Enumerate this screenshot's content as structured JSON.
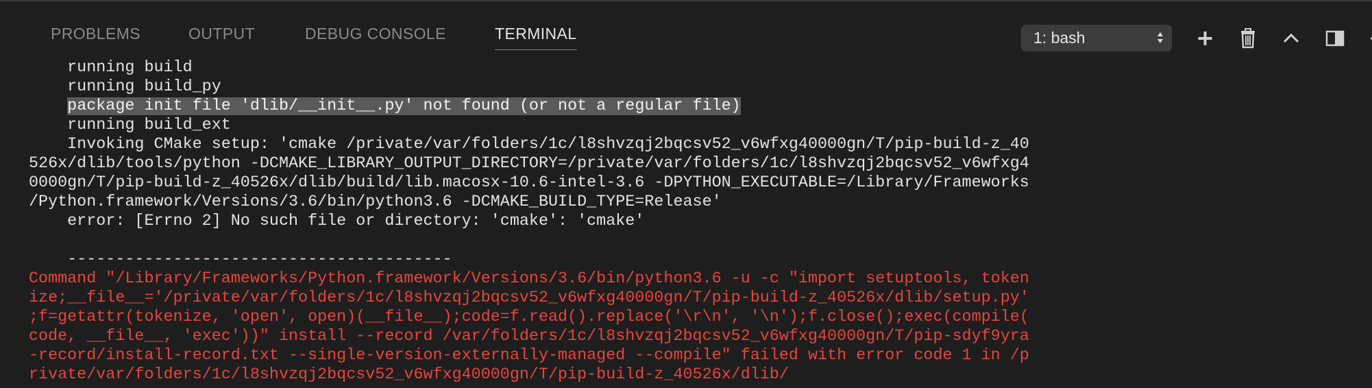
{
  "tabs": [
    {
      "label": "PROBLEMS"
    },
    {
      "label": "OUTPUT"
    },
    {
      "label": "DEBUG CONSOLE"
    },
    {
      "label": "TERMINAL",
      "active": true
    }
  ],
  "toolbar": {
    "terminal_select": "1: bash",
    "icons": [
      "plus-icon",
      "trash-icon",
      "chevron-up-icon",
      "split-panel-icon"
    ]
  },
  "terminal": {
    "lines": [
      "    running build",
      "    running build_py",
      {
        "pre": "    ",
        "selected": "package init file 'dlib/__init__.py' not found (or not a regular file)"
      },
      "    running build_ext",
      "    Invoking CMake setup: 'cmake /private/var/folders/1c/l8shvzqj2bqcsv52_v6wfxg40000gn/T/pip-build-z_40",
      "526x/dlib/tools/python -DCMAKE_LIBRARY_OUTPUT_DIRECTORY=/private/var/folders/1c/l8shvzqj2bqcsv52_v6wfxg4",
      "0000gn/T/pip-build-z_40526x/dlib/build/lib.macosx-10.6-intel-3.6 -DPYTHON_EXECUTABLE=/Library/Frameworks",
      "/Python.framework/Versions/3.6/bin/python3.6 -DCMAKE_BUILD_TYPE=Release'",
      "    error: [Errno 2] No such file or directory: 'cmake': 'cmake'",
      "",
      "    ----------------------------------------",
      {
        "err": "Command \"/Library/Frameworks/Python.framework/Versions/3.6/bin/python3.6 -u -c \"import setuptools, token"
      },
      {
        "err": "ize;__file__='/private/var/folders/1c/l8shvzqj2bqcsv52_v6wfxg40000gn/T/pip-build-z_40526x/dlib/setup.py'"
      },
      {
        "err": ";f=getattr(tokenize, 'open', open)(__file__);code=f.read().replace('\\r\\n', '\\n');f.close();exec(compile("
      },
      {
        "err": "code, __file__, 'exec'))\" install --record /var/folders/1c/l8shvzqj2bqcsv52_v6wfxg40000gn/T/pip-sdyf9yra"
      },
      {
        "err": "-record/install-record.txt --single-version-externally-managed --compile\" failed with error code 1 in /p"
      },
      {
        "err": "rivate/var/folders/1c/l8shvzqj2bqcsv52_v6wfxg40000gn/T/pip-build-z_40526x/dlib/"
      }
    ]
  }
}
